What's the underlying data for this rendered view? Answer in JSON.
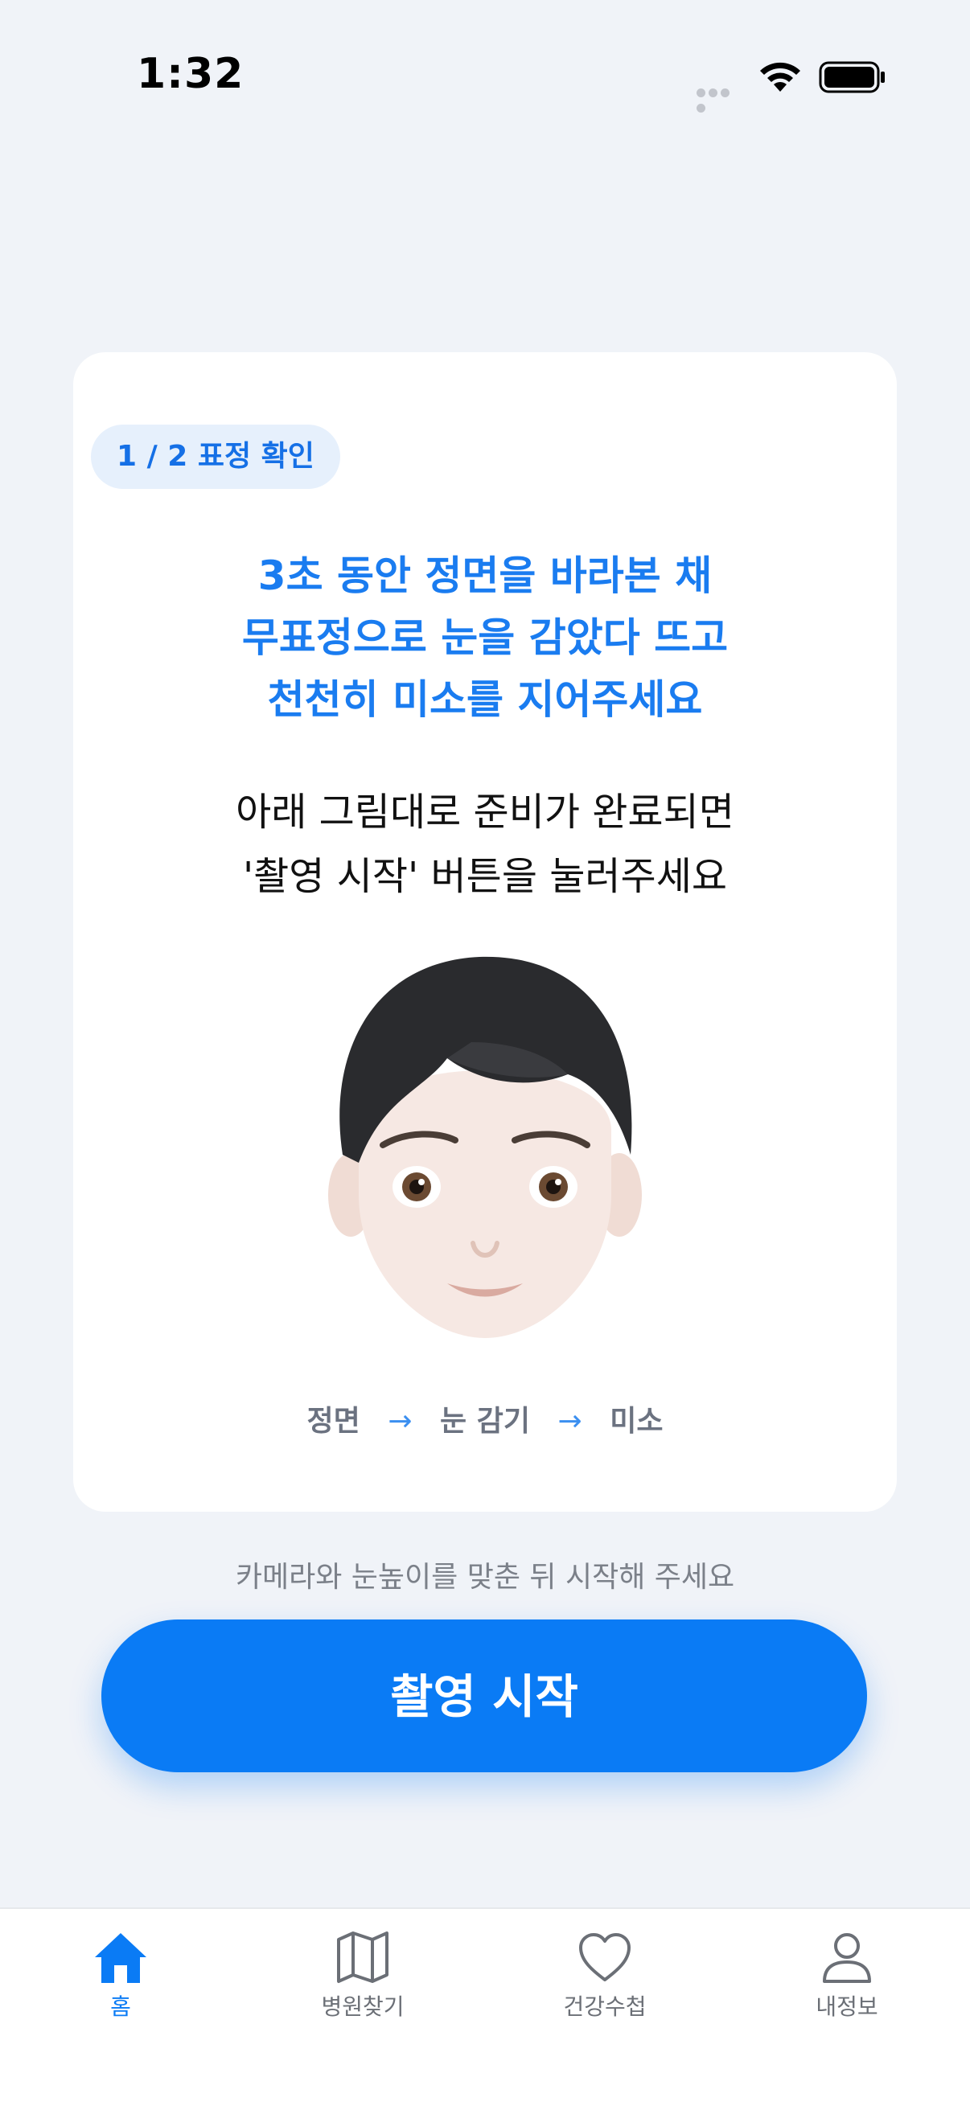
{
  "status_bar": {
    "time": "1:32"
  },
  "card": {
    "step_badge": "1 / 2  표정 확인",
    "instruction_main": [
      "3초 동안 정면을 바라본 채",
      "무표정으로 눈을 감았다 뜨고",
      "천천히 미소를 지어주세요"
    ],
    "instruction_sub": [
      "아래 그림대로 준비가 완료되면",
      "'촬영 시작' 버튼을 눌러주세요"
    ],
    "sequence": [
      "정면",
      "눈 감기",
      "미소"
    ],
    "sequence_arrow": "→"
  },
  "hint": "카메라와 눈높이를 맞춘 뒤 시작해 주세요",
  "start_button": "촬영 시작",
  "tabs": [
    {
      "label": "홈",
      "icon": "home-icon",
      "active": true
    },
    {
      "label": "병원찾기",
      "icon": "map-icon",
      "active": false
    },
    {
      "label": "건강수첩",
      "icon": "heart-icon",
      "active": false
    },
    {
      "label": "내정보",
      "icon": "person-icon",
      "active": false
    }
  ],
  "colors": {
    "accent": "#0a7bf5",
    "background": "#f0f3f8",
    "card": "#ffffff",
    "inactive": "#6b6f76"
  }
}
